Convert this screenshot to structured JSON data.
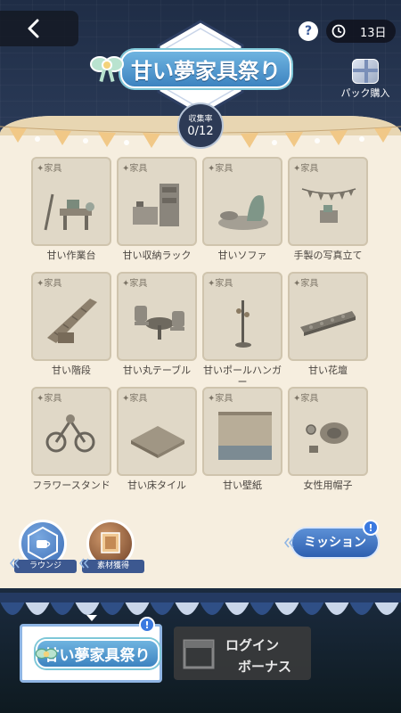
{
  "header": {
    "back_icon": "chevron-left-icon",
    "help_label": "?",
    "timer_text": "13日",
    "event_title": "甘い夢家具祭り",
    "collection_label": "収集率",
    "collection_value": "0/12",
    "pack_label": "パック購入"
  },
  "items": [
    {
      "tag": "✦家具",
      "name": "甘い作業台"
    },
    {
      "tag": "✦家具",
      "name": "甘い収納ラック"
    },
    {
      "tag": "✦家具",
      "name": "甘いソファ"
    },
    {
      "tag": "✦家具",
      "name": "手製の写真立て"
    },
    {
      "tag": "✦家具",
      "name": "甘い階段"
    },
    {
      "tag": "✦家具",
      "name": "甘い丸テーブル"
    },
    {
      "tag": "✦家具",
      "name": "甘いポールハンガー"
    },
    {
      "tag": "✦家具",
      "name": "甘い花壇"
    },
    {
      "tag": "✦家具",
      "name": "フラワースタンド"
    },
    {
      "tag": "✦家具",
      "name": "甘い床タイル"
    },
    {
      "tag": "✦家具",
      "name": "甘い壁紙"
    },
    {
      "tag": "✦家具",
      "name": "女性用帽子"
    }
  ],
  "actions": {
    "lounge_label": "ラウンジ",
    "material_label": "素材獲得",
    "mission_label": "ミッション",
    "alert_symbol": "!"
  },
  "bottom_tabs": {
    "event_title": "甘い夢家具祭り",
    "login_line1": "ログイン",
    "login_line2": "ボーナス"
  }
}
